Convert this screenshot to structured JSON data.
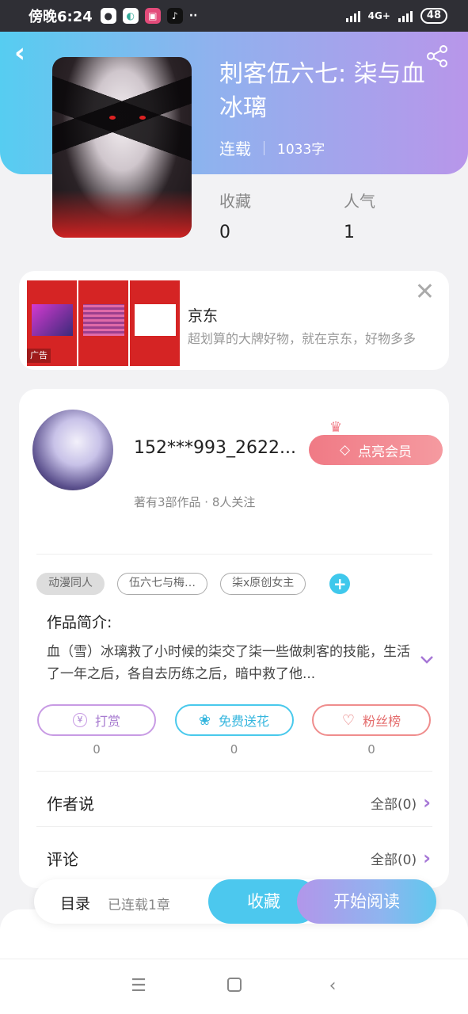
{
  "status_bar": {
    "time": "傍晚6:24",
    "network": "4G+",
    "battery": "48"
  },
  "book": {
    "title": "刺客伍六七: 柒与血冰璃",
    "status": "连载",
    "word_count": "1033字",
    "favorites_label": "收藏",
    "favorites_value": "0",
    "popularity_label": "人气",
    "popularity_value": "1"
  },
  "ad": {
    "brand": "京东",
    "description": "超划算的大牌好物，就在京东，好物多多",
    "tag": "广告"
  },
  "author": {
    "name": "152***993_2622...",
    "stats": "著有3部作品 · 8人关注",
    "vip_button": "点亮会员"
  },
  "tags": [
    "动漫同人",
    "伍六七与梅…",
    "柒x原创女主"
  ],
  "intro": {
    "title": "作品简介:",
    "text": "血（雪）冰璃救了小时候的柒交了柒一些做刺客的技能，生活了一年之后，各自去历练之后，暗中救了他..."
  },
  "actions": [
    {
      "label": "打赏",
      "count": "0"
    },
    {
      "label": "免费送花",
      "count": "0"
    },
    {
      "label": "粉丝榜",
      "count": "0"
    }
  ],
  "sections": {
    "author_says": {
      "title": "作者说",
      "right": "全部(0)"
    },
    "comments": {
      "title": "评论",
      "right": "全部(0)"
    }
  },
  "bottom": {
    "toc": "目录",
    "toc_sub": "已连载1章",
    "favorite": "收藏",
    "read": "开始阅读"
  },
  "icons": [
    "back-icon",
    "share-icon",
    "close-icon",
    "crown-icon",
    "diamond-icon",
    "add-icon",
    "chevron-down-icon",
    "yen-icon",
    "flower-icon",
    "user-heart-icon",
    "chevron-right-icon",
    "menu-icon",
    "home-icon",
    "nav-back-icon"
  ]
}
